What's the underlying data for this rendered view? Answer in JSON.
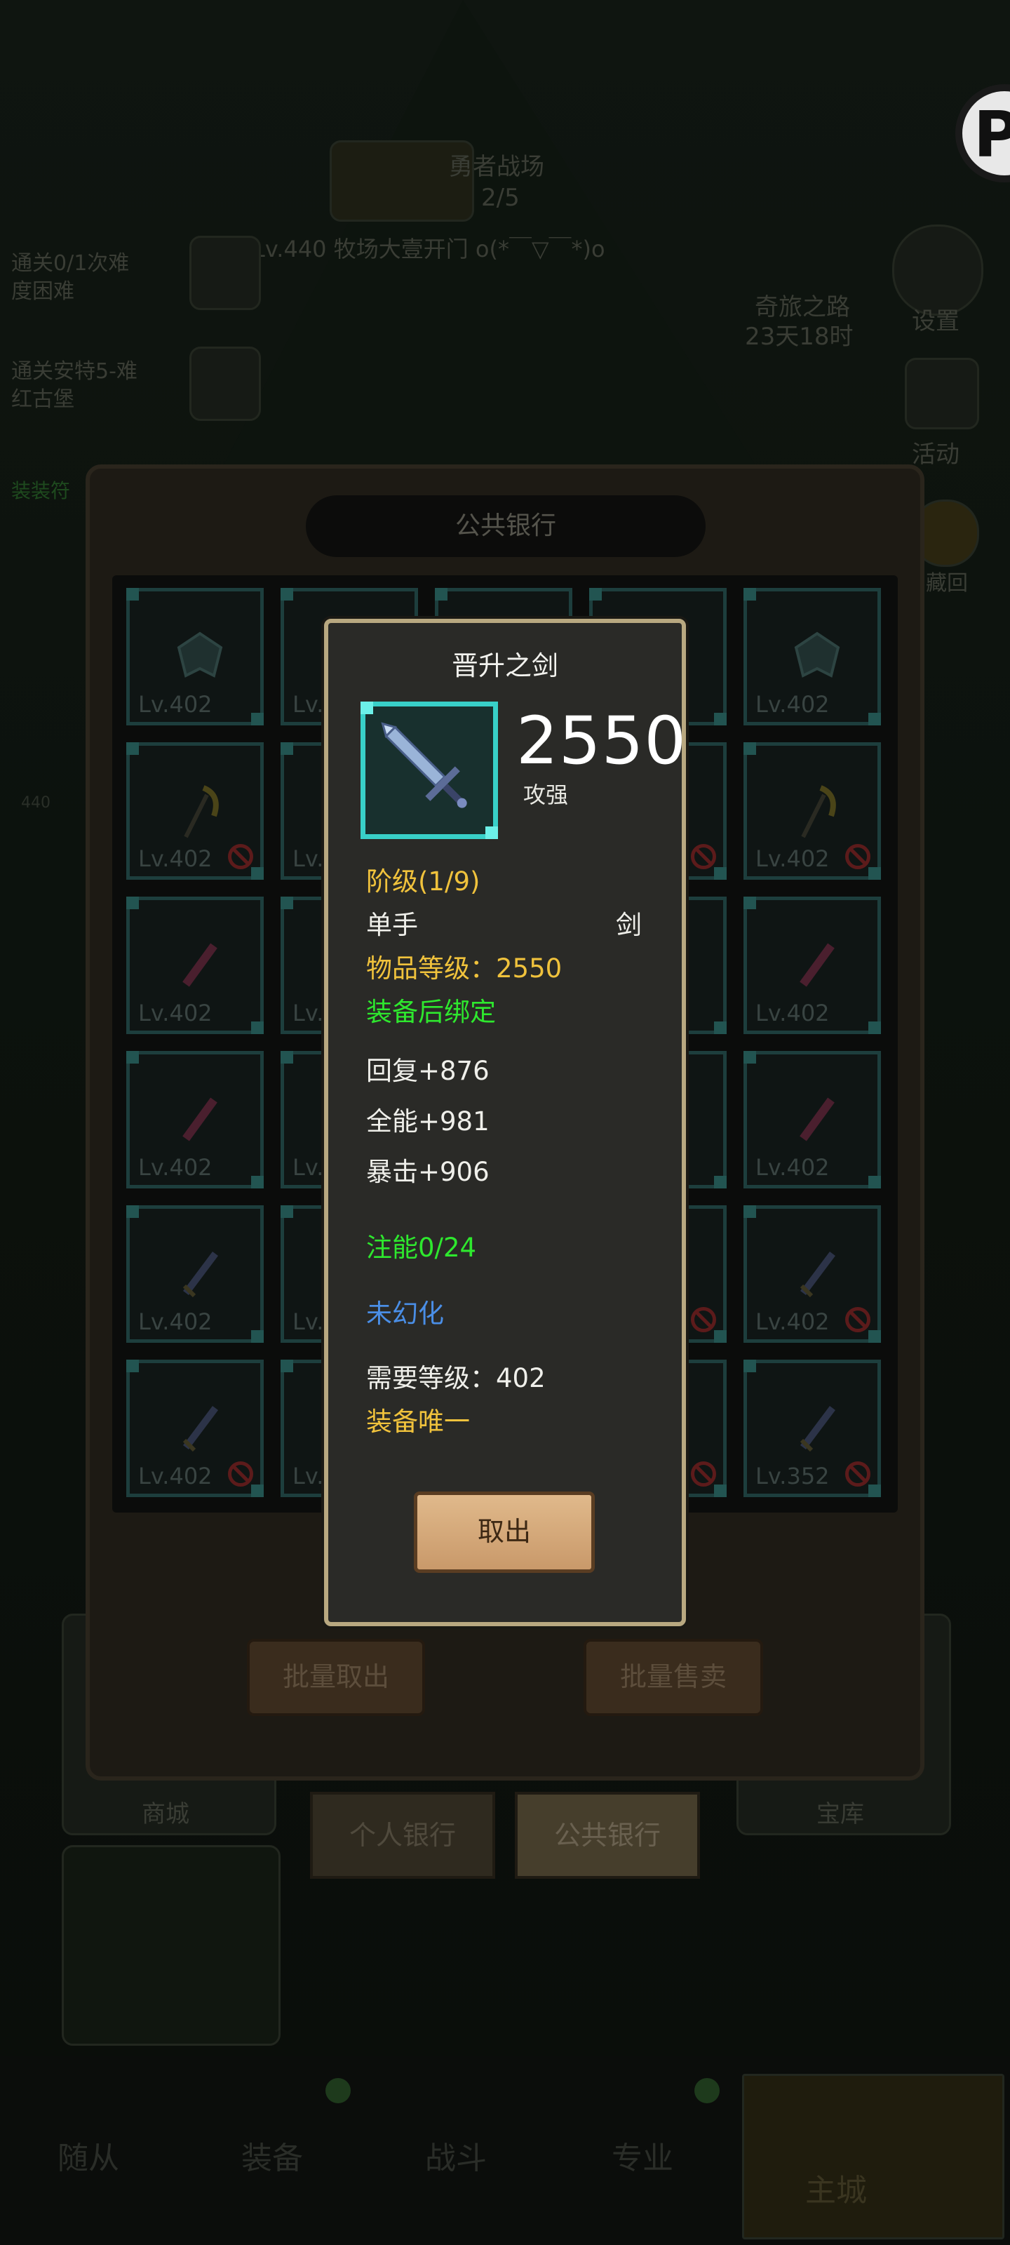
{
  "background": {
    "battle_title": "勇者战场",
    "battle_progress": "2/5",
    "player_name": "Lv.440 牧场大壹开门 o(*￣▽￣*)o",
    "quest1_line1": "通关0/1次难",
    "quest1_line2": "度困难",
    "quest2_line1": "通关安特5-难",
    "quest2_line2": "红古堡",
    "event_line1": "奇旅之路",
    "event_line2": "23天18时",
    "side_settings": "设置",
    "side_activity": "活动",
    "side_label3": "藏回",
    "left_label3": "装装符",
    "lower_left": "商城",
    "lower_right": "宝库",
    "lvl_badge": "440",
    "nav": [
      "随从",
      "装备",
      "战斗",
      "专业",
      "主城"
    ]
  },
  "bank": {
    "title": "公共银行",
    "batch_take": "批量取出",
    "batch_sell": "批量售卖",
    "tab_personal": "个人银行",
    "tab_public": "公共银行",
    "cells": [
      {
        "lv": "Lv.402",
        "ban": false
      },
      {
        "lv": "Lv.",
        "ban": false
      },
      {
        "lv": "",
        "ban": false
      },
      {
        "lv": "",
        "ban": false
      },
      {
        "lv": "Lv.402",
        "ban": false
      },
      {
        "lv": "Lv.402",
        "ban": true
      },
      {
        "lv": "Lv.",
        "ban": false
      },
      {
        "lv": "",
        "ban": false
      },
      {
        "lv": "",
        "ban": true
      },
      {
        "lv": "Lv.402",
        "ban": true
      },
      {
        "lv": "Lv.402",
        "ban": false
      },
      {
        "lv": "Lv.",
        "ban": false
      },
      {
        "lv": "",
        "ban": false
      },
      {
        "lv": "",
        "ban": false
      },
      {
        "lv": "Lv.402",
        "ban": false
      },
      {
        "lv": "Lv.402",
        "ban": false
      },
      {
        "lv": "Lv.",
        "ban": false
      },
      {
        "lv": "",
        "ban": false
      },
      {
        "lv": "",
        "ban": false
      },
      {
        "lv": "Lv.402",
        "ban": false
      },
      {
        "lv": "Lv.402",
        "ban": false
      },
      {
        "lv": "Lv.",
        "ban": false
      },
      {
        "lv": "",
        "ban": false
      },
      {
        "lv": "",
        "ban": true
      },
      {
        "lv": "Lv.402",
        "ban": true
      },
      {
        "lv": "Lv.402",
        "ban": true
      },
      {
        "lv": "Lv.",
        "ban": false
      },
      {
        "lv": "",
        "ban": false
      },
      {
        "lv": "",
        "ban": true
      },
      {
        "lv": "Lv.352",
        "ban": true
      }
    ]
  },
  "item": {
    "name": "晋升之剑",
    "power": "2550",
    "power_label": "攻强",
    "tier": "阶级(1/9)",
    "hand": "单手",
    "weapon_type": "剑",
    "item_level": "物品等级：2550",
    "bind": "装备后绑定",
    "stat1": "回复+876",
    "stat2": "全能+981",
    "stat3": "暴击+906",
    "infuse": "注能0/24",
    "transmog": "未幻化",
    "req_level": "需要等级：402",
    "unique": "装备唯一",
    "take_button": "取出"
  },
  "colors": {
    "gold": "#f0c23c",
    "green": "#2ee82e",
    "blue": "#4a8ee6",
    "icon_border": "#38d0c8"
  }
}
